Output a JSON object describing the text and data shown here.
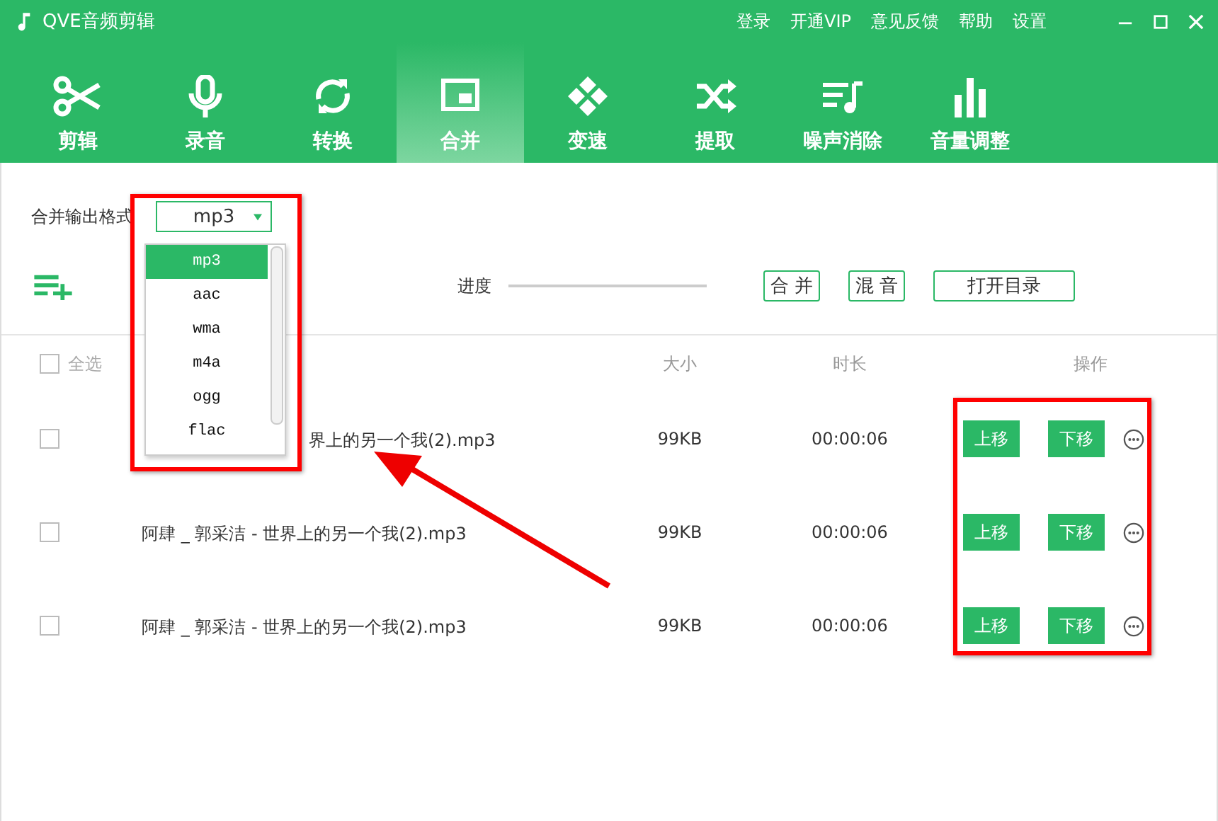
{
  "app": {
    "title": "QVE音频剪辑"
  },
  "top_links": [
    "登录",
    "开通VIP",
    "意见反馈",
    "帮助",
    "设置"
  ],
  "tabs": [
    {
      "label": "剪辑",
      "kind": "scissors",
      "selected": false
    },
    {
      "label": "录音",
      "kind": "mic",
      "selected": false
    },
    {
      "label": "转换",
      "kind": "convert",
      "selected": false
    },
    {
      "label": "合并",
      "kind": "merge",
      "selected": true
    },
    {
      "label": "变速",
      "kind": "speed",
      "selected": false
    },
    {
      "label": "提取",
      "kind": "shuffle",
      "selected": false
    },
    {
      "label": "噪声消除",
      "kind": "denoise",
      "selected": false
    },
    {
      "label": "音量调整",
      "kind": "volume",
      "selected": false
    }
  ],
  "format": {
    "label": "合并输出格式",
    "value": "mp3",
    "open": true,
    "options": [
      {
        "label": "mp3",
        "selected": true
      },
      {
        "label": "aac",
        "selected": false
      },
      {
        "label": "wma",
        "selected": false
      },
      {
        "label": "m4a",
        "selected": false
      },
      {
        "label": "ogg",
        "selected": false
      },
      {
        "label": "flac",
        "selected": false
      }
    ]
  },
  "toolbar": {
    "progress": {
      "label": "进度",
      "level": 0
    },
    "buttons": [
      "合 并",
      "混 音",
      "打开目录"
    ]
  },
  "table": {
    "select_all": {
      "label": "全选",
      "checked": false
    },
    "columns": [
      "大小",
      "时长",
      "操作"
    ],
    "rows": [
      {
        "name": "界上的另一个我(2).mp3",
        "size": "99KB",
        "duration": "00:00:06",
        "checked": false,
        "actions": [
          "上移",
          "下移"
        ]
      },
      {
        "name": "阿肆 _ 郭采洁 - 世界上的另一个我(2).mp3",
        "size": "99KB",
        "duration": "00:00:06",
        "checked": false,
        "actions": [
          "上移",
          "下移"
        ]
      },
      {
        "name": "阿肆 _ 郭采洁 - 世界上的另一个我(2).mp3",
        "size": "99KB",
        "duration": "00:00:06",
        "checked": false,
        "actions": [
          "上移",
          "下移"
        ]
      }
    ]
  }
}
